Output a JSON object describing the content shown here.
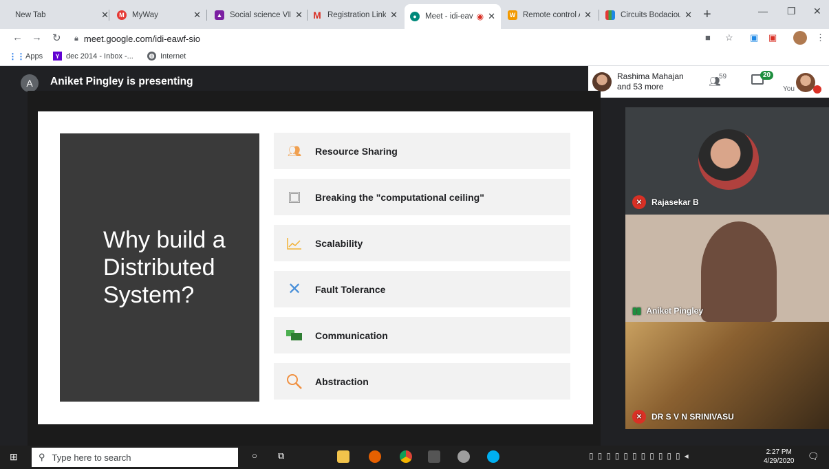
{
  "tabs": [
    {
      "title": "New Tab",
      "fav": ""
    },
    {
      "title": "MyWay",
      "fav": "myway-icon"
    },
    {
      "title": "Social science VII",
      "fav": "classroom-icon"
    },
    {
      "title": "Registration Link F",
      "fav": "gmail-icon"
    },
    {
      "title": "Meet - idi-eav",
      "fav": "meet-icon",
      "active": true
    },
    {
      "title": "Remote control Ar",
      "fav": "dictionary-icon"
    },
    {
      "title": "Circuits Bodacious",
      "fav": "grid-icon"
    }
  ],
  "address": {
    "url": "meet.google.com/idi-eawf-sio"
  },
  "bookmarks": [
    "Apps",
    "dec 2014 - Inbox -...",
    "Internet"
  ],
  "meet": {
    "presenter_initial": "A",
    "presenter_text": "Aniket Pingley is presenting",
    "participants_line1": "Rashima Mahajan",
    "participants_line2": "and 53 more",
    "people_count": "59",
    "chat_count": "20",
    "you_label": "You"
  },
  "slide": {
    "title": "Why build a Distributed System?",
    "items": [
      {
        "label": "Resource Sharing",
        "icon": "people-icon",
        "color": "#f0a050"
      },
      {
        "label": "Breaking the \"computational ceiling\"",
        "icon": "chip-icon",
        "color": "#9e9e9e"
      },
      {
        "label": "Scalability",
        "icon": "growth-chart-icon",
        "color": "#f2b134"
      },
      {
        "label": "Fault Tolerance",
        "icon": "x-icon",
        "color": "#4a90d9"
      },
      {
        "label": "Communication",
        "icon": "chat-bubbles-icon",
        "color": "#4caf50"
      },
      {
        "label": "Abstraction",
        "icon": "magnifier-icon",
        "color": "#f09040"
      }
    ]
  },
  "tiles": [
    {
      "name": "Rajasekar B",
      "muted": true
    },
    {
      "name": "Aniket Pingley",
      "muted": false
    },
    {
      "name": "DR S V N SRINIVASU",
      "muted": true
    }
  ],
  "taskbar": {
    "search_placeholder": "Type here to search",
    "time": "2:27 PM",
    "date": "4/29/2020"
  }
}
